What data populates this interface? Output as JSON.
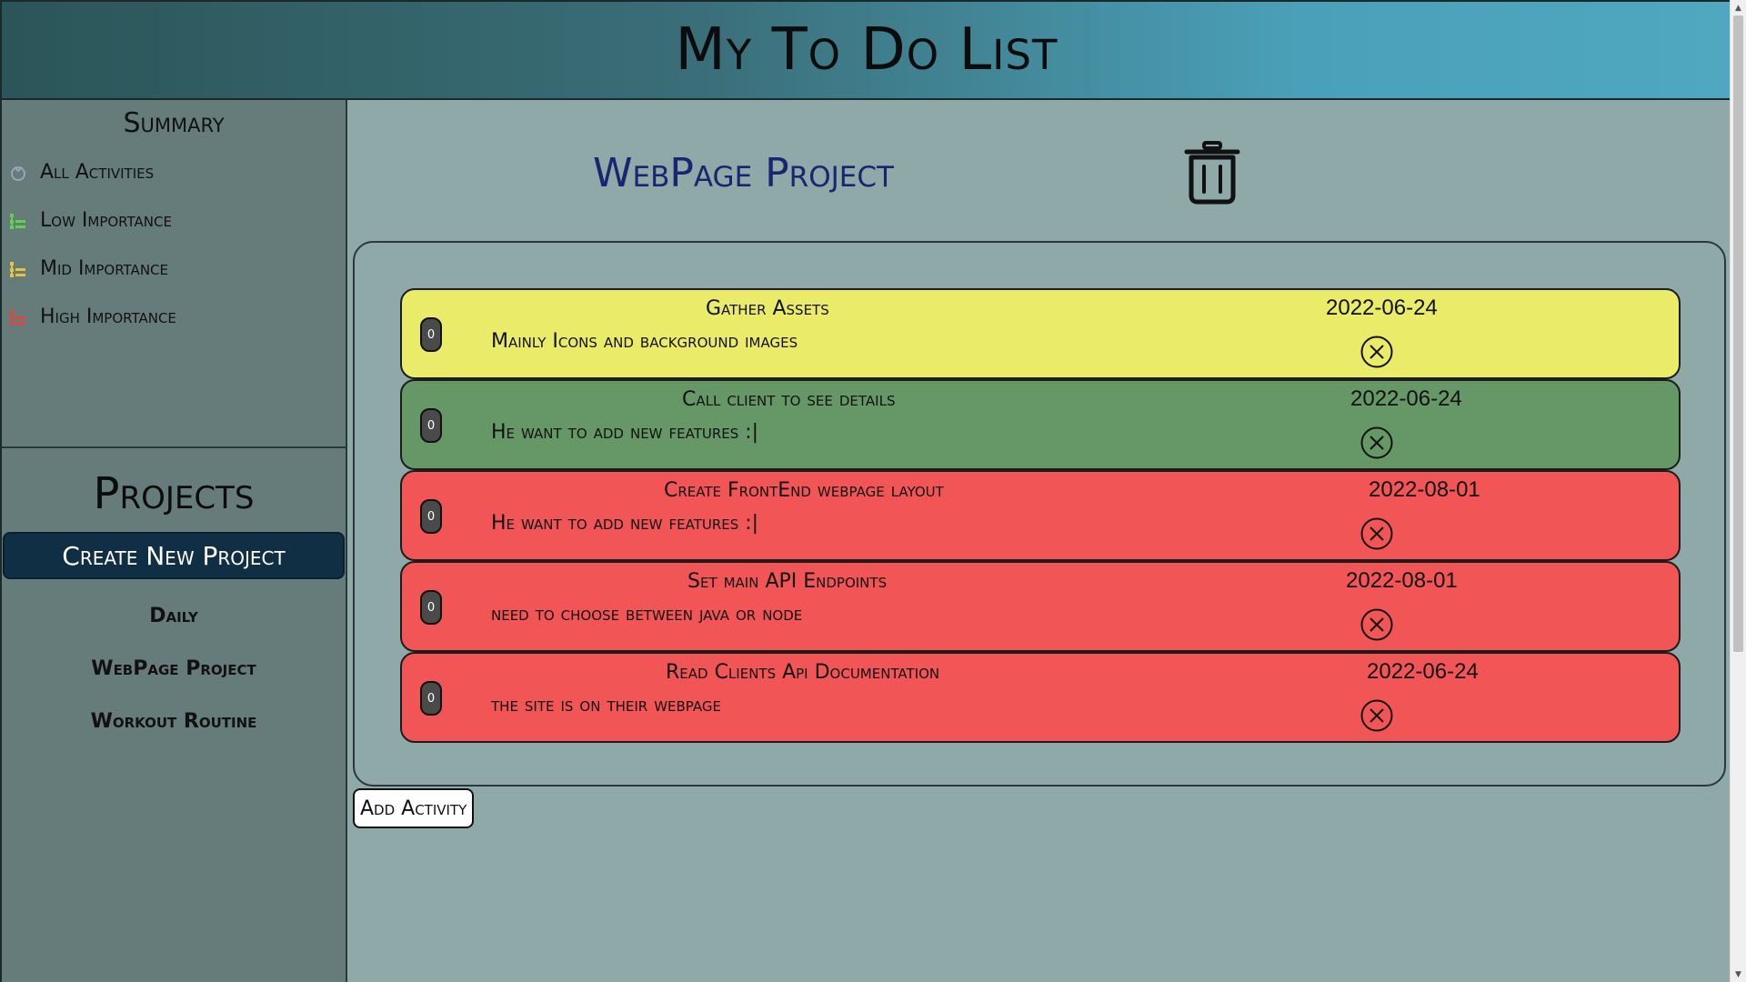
{
  "header": {
    "title": "My To Do List"
  },
  "sidebar": {
    "summary_title": "Summary",
    "summary_items": [
      {
        "label": "All Activities",
        "icon": "all-activities-icon",
        "color": "#9aa6b6"
      },
      {
        "label": "Low Importance",
        "icon": "list-icon",
        "color": "#5fd44a"
      },
      {
        "label": "Mid Importance",
        "icon": "list-icon",
        "color": "#e8c23a"
      },
      {
        "label": "High Importance",
        "icon": "list-icon",
        "color": "#e0463a"
      }
    ],
    "projects_title": "Projects",
    "create_button": "Create New Project",
    "projects": [
      "Daily",
      "WebPage Project",
      "Workout Routine"
    ]
  },
  "main": {
    "project_title": "WebPage Project",
    "add_activity": "Add Activity",
    "activities": [
      {
        "title": "Gather Assets",
        "description": "Mainly Icons and background images",
        "date": "2022-06-24",
        "count": "0",
        "importance": "mid",
        "color": "#ebeb6a"
      },
      {
        "title": "Call client to see details",
        "description": "He want to add new features :|",
        "date": "2022-06-24",
        "count": "0",
        "importance": "low",
        "color": "#659866"
      },
      {
        "title": "Create FrontEnd webpage layout",
        "description": "He want to add new features :|",
        "date": "2022-08-01",
        "count": "0",
        "importance": "high",
        "color": "#f25555"
      },
      {
        "title": "Set main API Endpoints",
        "description": "need to choose between java or node",
        "date": "2022-08-01",
        "count": "0",
        "importance": "high",
        "color": "#f25555"
      },
      {
        "title": "Read Clients Api Documentation",
        "description": "the site is on their webpage",
        "date": "2022-06-24",
        "count": "0",
        "importance": "high",
        "color": "#f25555"
      }
    ]
  }
}
